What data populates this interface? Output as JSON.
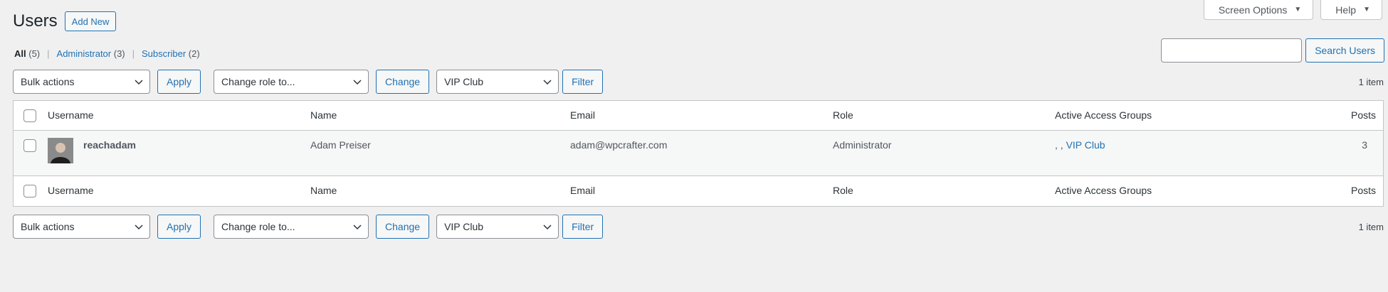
{
  "screen_meta": {
    "screen_options": "Screen Options",
    "help": "Help"
  },
  "heading": {
    "title": "Users",
    "add_new": "Add New"
  },
  "filters": {
    "all_label": "All",
    "all_count": "(5)",
    "admin_label": "Administrator",
    "admin_count": "(3)",
    "subscriber_label": "Subscriber",
    "subscriber_count": "(2)"
  },
  "search": {
    "button": "Search Users",
    "placeholder": ""
  },
  "tablenav": {
    "bulk_actions": "Bulk actions",
    "apply": "Apply",
    "change_role": "Change role to...",
    "change": "Change",
    "group": "VIP Club",
    "filter": "Filter",
    "items": "1 item"
  },
  "columns": {
    "username": "Username",
    "name": "Name",
    "email": "Email",
    "role": "Role",
    "groups": "Active Access Groups",
    "posts": "Posts"
  },
  "rows": [
    {
      "username": "reachadam",
      "name": "Adam Preiser",
      "email": "adam@wpcrafter.com",
      "role": "Administrator",
      "groups_prefix": ", , ",
      "groups_link": "VIP Club",
      "posts": "3"
    }
  ],
  "colors": {
    "link": "#2271b1",
    "border": "#c3c4c7",
    "background": "#f0f0f1"
  }
}
